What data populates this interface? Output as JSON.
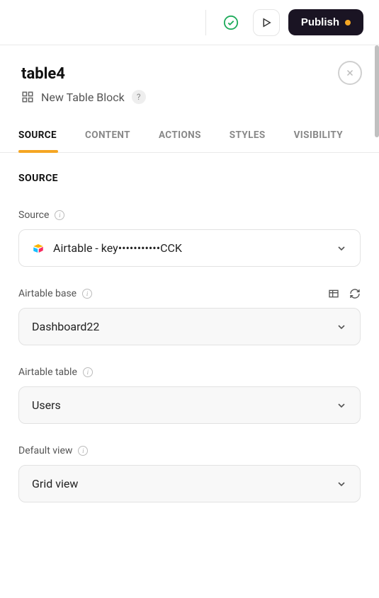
{
  "topbar": {
    "publish_label": "Publish"
  },
  "header": {
    "title": "table4",
    "subtitle": "New Table Block"
  },
  "tabs": [
    {
      "label": "SOURCE",
      "active": true
    },
    {
      "label": "CONTENT",
      "active": false
    },
    {
      "label": "ACTIONS",
      "active": false
    },
    {
      "label": "STYLES",
      "active": false
    },
    {
      "label": "VISIBILITY",
      "active": false
    }
  ],
  "section": {
    "title": "SOURCE"
  },
  "fields": {
    "source": {
      "label": "Source",
      "value": "Airtable - key•••••••••••CCK"
    },
    "airtable_base": {
      "label": "Airtable base",
      "value": "Dashboard22"
    },
    "airtable_table": {
      "label": "Airtable table",
      "value": "Users"
    },
    "default_view": {
      "label": "Default view",
      "value": "Grid view"
    }
  }
}
